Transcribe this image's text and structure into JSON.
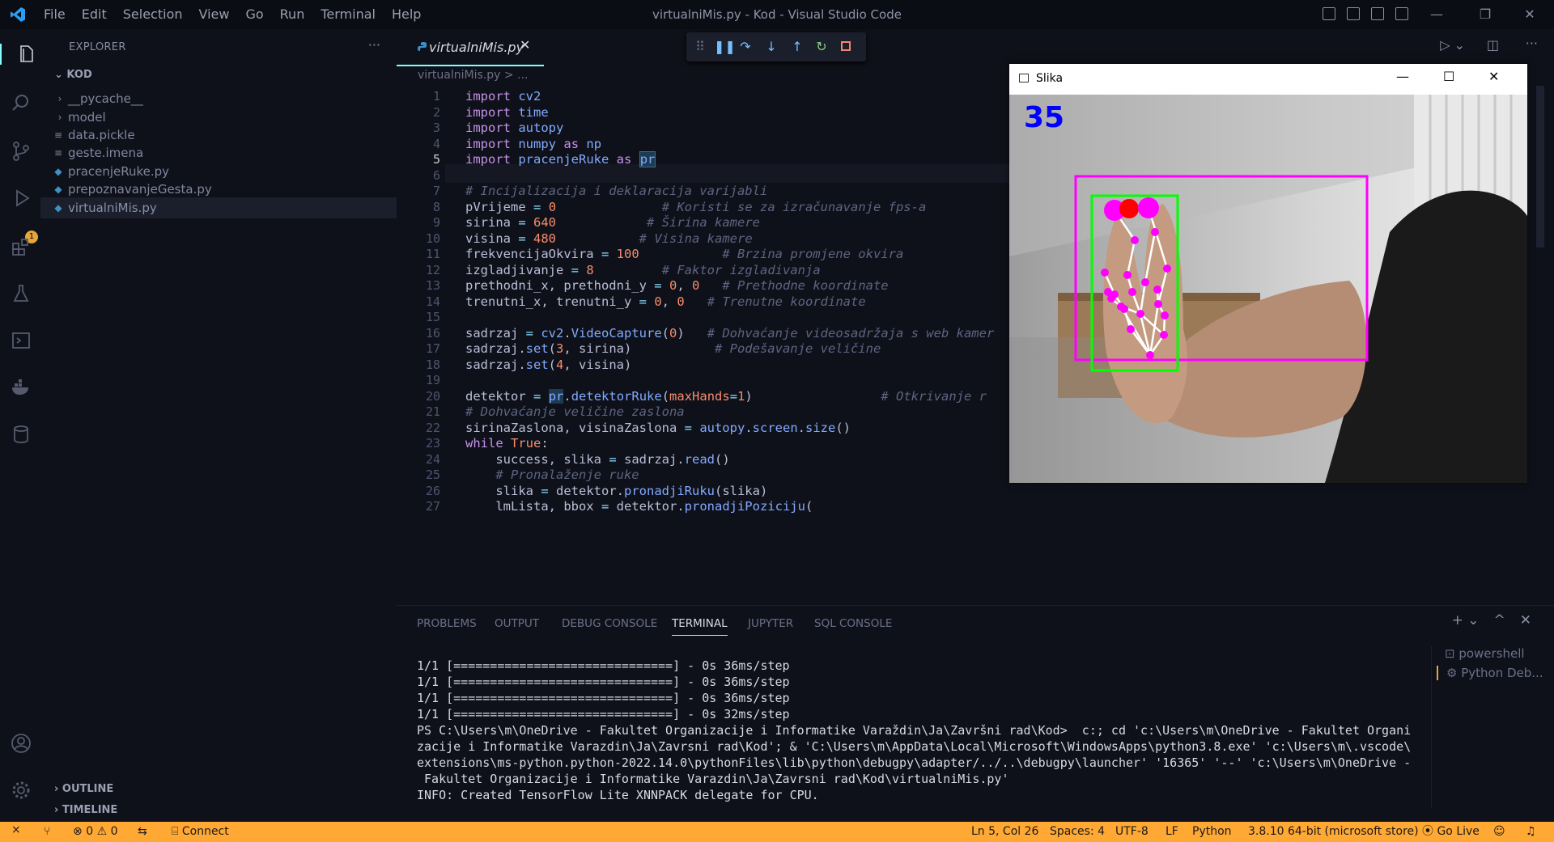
{
  "window": {
    "title": "virtualniMis.py - Kod - Visual Studio Code",
    "menu": [
      "File",
      "Edit",
      "Selection",
      "View",
      "Go",
      "Run",
      "Terminal",
      "Help"
    ]
  },
  "activity": {
    "debug_badge": "1"
  },
  "explorer": {
    "header": "EXPLORER",
    "more": "···",
    "root": "KOD",
    "items": [
      {
        "label": "__pycache__",
        "icon": "chevron-right"
      },
      {
        "label": "model",
        "icon": "chevron-right"
      },
      {
        "label": "data.pickle",
        "icon": "file-lines"
      },
      {
        "label": "geste.imena",
        "icon": "file-lines"
      },
      {
        "label": "pracenjeRuke.py",
        "icon": "python"
      },
      {
        "label": "prepoznavanjeGesta.py",
        "icon": "python"
      },
      {
        "label": "virtualniMis.py",
        "icon": "python"
      }
    ],
    "outline": "OUTLINE",
    "timeline": "TIMELINE"
  },
  "editor": {
    "tab": "virtualniMis.py",
    "tab_close": "✕",
    "breadcrumb": "virtualniMis.py > ...",
    "line_numbers": [
      "1",
      "2",
      "3",
      "4",
      "5",
      "6",
      "7",
      "8",
      "9",
      "10",
      "11",
      "12",
      "13",
      "14",
      "15",
      "16",
      "17",
      "18",
      "19",
      "20",
      "21",
      "22",
      "23",
      "24",
      "25",
      "26",
      "27"
    ]
  },
  "image_window": {
    "title": "Slika",
    "fps": "35",
    "btn_min": "—",
    "btn_max": "☐",
    "btn_close": "✕"
  },
  "panel": {
    "tabs": [
      "PROBLEMS",
      "OUTPUT",
      "DEBUG CONSOLE",
      "TERMINAL",
      "JUPYTER",
      "SQL CONSOLE"
    ],
    "active_tab": "TERMINAL",
    "actions": "+ ⌄  ^  ✕",
    "terminal_lines": [
      "1/1 [==============================] - 0s 36ms/step",
      "1/1 [==============================] - 0s 36ms/step",
      "1/1 [==============================] - 0s 36ms/step",
      "1/1 [==============================] - 0s 32ms/step",
      "PS C:\\Users\\m\\OneDrive - Fakultet Organizacije i Informatike Varaždin\\Ja\\Završni rad\\Kod>  c:; cd 'c:\\Users\\m\\OneDrive - Fakultet Organi",
      "zacije i Informatike Varazdin\\Ja\\Zavrsni rad\\Kod'; & 'C:\\Users\\m\\AppData\\Local\\Microsoft\\WindowsApps\\python3.8.exe' 'c:\\Users\\m\\.vscode\\",
      "extensions\\ms-python.python-2022.14.0\\pythonFiles\\lib\\python\\debugpy\\adapter/../..\\debugpy\\launcher' '16365' '--' 'c:\\Users\\m\\OneDrive -",
      " Fakultet Organizacije i Informatike Varazdin\\Ja\\Zavrsni rad\\Kod\\virtualniMis.py'",
      "INFO: Created TensorFlow Lite XNNPACK delegate for CPU."
    ],
    "sessions": [
      "powershell",
      "Python Deb..."
    ]
  },
  "status": {
    "errors": "0",
    "warnings": "0",
    "connect": "Connect",
    "position": "Ln 5, Col 26",
    "spaces": "Spaces: 4",
    "encoding": "UTF-8",
    "eol": "LF",
    "language": "Python",
    "interpreter": "3.8.10 64-bit (microsoft store)",
    "golive": "Go Live"
  },
  "colors": {
    "accent": "#84ffff",
    "statusbar": "#ffa834",
    "bbox_outer": "#ff00ff",
    "bbox_inner": "#00ff00",
    "landmark": "#ff00ff",
    "fingertip_active": "#ff0000"
  }
}
